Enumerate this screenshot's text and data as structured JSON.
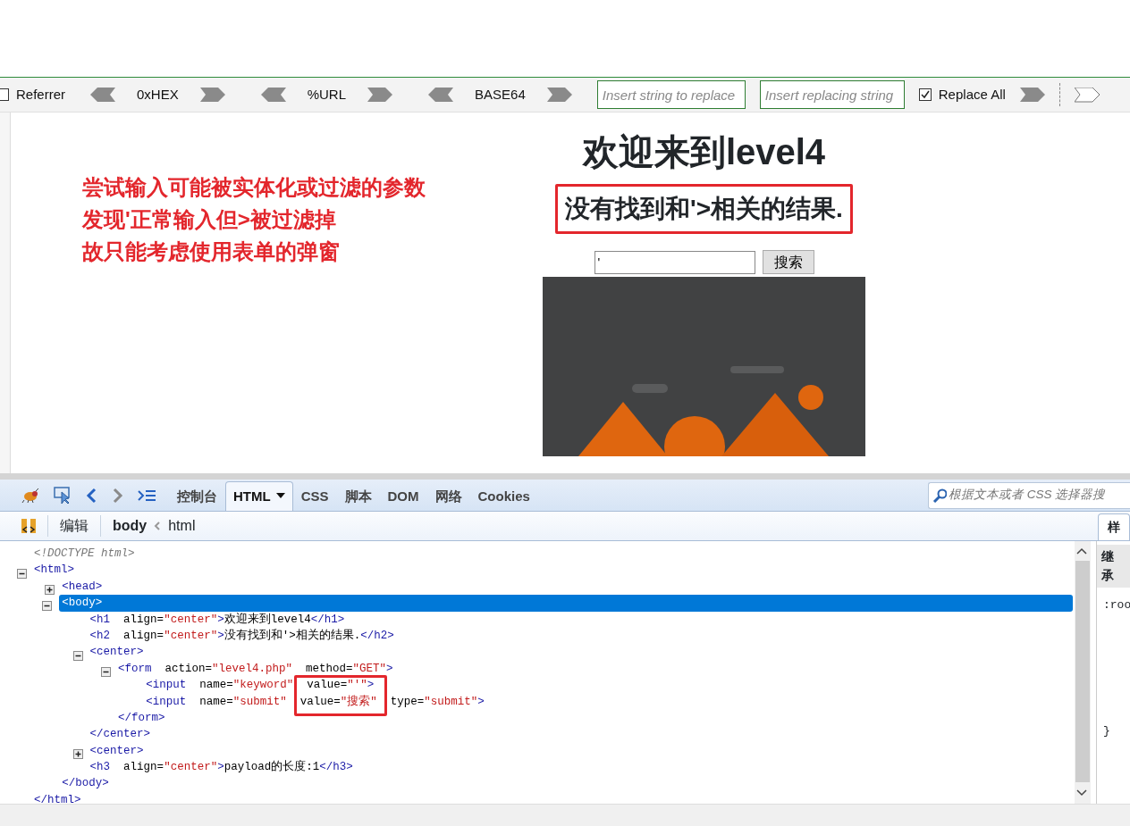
{
  "hackbar": {
    "items": [
      {
        "kind": "checkbox",
        "label": "Referrer",
        "checked": false
      },
      {
        "kind": "codec",
        "label": "0xHEX"
      },
      {
        "kind": "codec",
        "label": "%URL"
      },
      {
        "kind": "codec",
        "label": "BASE64"
      },
      {
        "kind": "field",
        "placeholder": "Insert string to replace"
      },
      {
        "kind": "field",
        "placeholder": "Insert replacing string"
      },
      {
        "kind": "checkbox",
        "label": "Replace All",
        "checked": true
      },
      {
        "kind": "arrows"
      }
    ]
  },
  "page": {
    "annotations": [
      "尝试输入可能被实体化或过滤的参数",
      "发现'正常输入但>被过滤掉",
      "故只能考虑使用表单的弹窗"
    ],
    "heading": "欢迎来到level4",
    "subheading": "没有找到和'>相关的结果.",
    "search": {
      "value": "'",
      "button": "搜索"
    }
  },
  "firebug": {
    "tabs": [
      {
        "label": "控制台",
        "selected": false,
        "dropdown": false
      },
      {
        "label": "HTML",
        "selected": true,
        "dropdown": true
      },
      {
        "label": "CSS",
        "selected": false,
        "dropdown": false
      },
      {
        "label": "脚本",
        "selected": false,
        "dropdown": false
      },
      {
        "label": "DOM",
        "selected": false,
        "dropdown": false
      },
      {
        "label": "网络",
        "selected": false,
        "dropdown": false
      },
      {
        "label": "Cookies",
        "selected": false,
        "dropdown": false
      }
    ],
    "search": {
      "placeholder": "根据文本或者 CSS 选择器搜"
    },
    "breadcrumb": {
      "edit": "编辑",
      "path": [
        "body",
        "html"
      ]
    },
    "tree": [
      {
        "selected": false,
        "tokens": [
          {
            "kind": "doctype",
            "text": "<!DOCTYPE html>"
          }
        ]
      },
      {
        "selected": false,
        "expanded": true,
        "tokens": [
          {
            "kind": "tag",
            "text": "<html>"
          }
        ],
        "children": [
          {
            "selected": false,
            "expanded": false,
            "tokens": [
              {
                "kind": "tag",
                "text": "<head>"
              }
            ]
          },
          {
            "selected": true,
            "expanded": true,
            "tokens": [
              {
                "kind": "tag",
                "text": "<body>"
              }
            ],
            "children": [
              {
                "selected": false,
                "tokens": [
                  {
                    "kind": "tag",
                    "text": "<h1"
                  },
                  {
                    "kind": "attr",
                    "text": "  align="
                  },
                  {
                    "kind": "val",
                    "text": "\"center\""
                  },
                  {
                    "kind": "tag",
                    "text": ">"
                  },
                  {
                    "kind": "text",
                    "text": "欢迎来到level4"
                  },
                  {
                    "kind": "tag",
                    "text": "</h1>"
                  }
                ]
              },
              {
                "selected": false,
                "tokens": [
                  {
                    "kind": "tag",
                    "text": "<h2"
                  },
                  {
                    "kind": "attr",
                    "text": "  align="
                  },
                  {
                    "kind": "val",
                    "text": "\"center\""
                  },
                  {
                    "kind": "tag",
                    "text": ">"
                  },
                  {
                    "kind": "text",
                    "text": "没有找到和'>相关的结果."
                  },
                  {
                    "kind": "tag",
                    "text": "</h2>"
                  }
                ]
              },
              {
                "selected": false,
                "expanded": true,
                "tokens": [
                  {
                    "kind": "tag",
                    "text": "<center>"
                  }
                ],
                "children": [
                  {
                    "selected": false,
                    "expanded": true,
                    "tokens": [
                      {
                        "kind": "tag",
                        "text": "<form"
                      },
                      {
                        "kind": "attr",
                        "text": "  action="
                      },
                      {
                        "kind": "val",
                        "text": "\"level4.php\""
                      },
                      {
                        "kind": "attr",
                        "text": "  method="
                      },
                      {
                        "kind": "val",
                        "text": "\"GET\""
                      },
                      {
                        "kind": "tag",
                        "text": ">"
                      }
                    ],
                    "children": [
                      {
                        "selected": false,
                        "tokens": [
                          {
                            "kind": "tag",
                            "text": "<input"
                          },
                          {
                            "kind": "attr",
                            "text": "  name="
                          },
                          {
                            "kind": "val",
                            "text": "\"keyword\""
                          },
                          {
                            "kind": "attr",
                            "text": "  value="
                          },
                          {
                            "kind": "val",
                            "text": "\"'\""
                          },
                          {
                            "kind": "tag",
                            "text": ">"
                          }
                        ]
                      },
                      {
                        "selected": false,
                        "tokens": [
                          {
                            "kind": "tag",
                            "text": "<input"
                          },
                          {
                            "kind": "attr",
                            "text": "  name="
                          },
                          {
                            "kind": "val",
                            "text": "\"submit\""
                          },
                          {
                            "kind": "attr",
                            "text": "  value="
                          },
                          {
                            "kind": "val",
                            "text": "\"搜索\""
                          },
                          {
                            "kind": "attr",
                            "text": "  type="
                          },
                          {
                            "kind": "val",
                            "text": "\"submit\""
                          },
                          {
                            "kind": "tag",
                            "text": ">"
                          }
                        ]
                      }
                    ],
                    "close": [
                      {
                        "kind": "tag",
                        "text": "</form>"
                      }
                    ]
                  }
                ],
                "close": [
                  {
                    "kind": "tag",
                    "text": "</center>"
                  }
                ]
              },
              {
                "selected": false,
                "expanded": false,
                "tokens": [
                  {
                    "kind": "tag",
                    "text": "<center>"
                  }
                ]
              },
              {
                "selected": false,
                "tokens": [
                  {
                    "kind": "tag",
                    "text": "<h3"
                  },
                  {
                    "kind": "attr",
                    "text": "  align="
                  },
                  {
                    "kind": "val",
                    "text": "\"center\""
                  },
                  {
                    "kind": "tag",
                    "text": ">"
                  },
                  {
                    "kind": "text",
                    "text": "payload的长度:1"
                  },
                  {
                    "kind": "tag",
                    "text": "</h3>"
                  }
                ]
              }
            ],
            "close": [
              {
                "kind": "tag",
                "text": "</body>"
              }
            ]
          }
        ],
        "close": [
          {
            "kind": "tag",
            "text": "</html>"
          }
        ]
      }
    ],
    "side_panel": {
      "tab": "样",
      "heading": "继承",
      "lines": [
        ":roo",
        "}"
      ]
    }
  }
}
